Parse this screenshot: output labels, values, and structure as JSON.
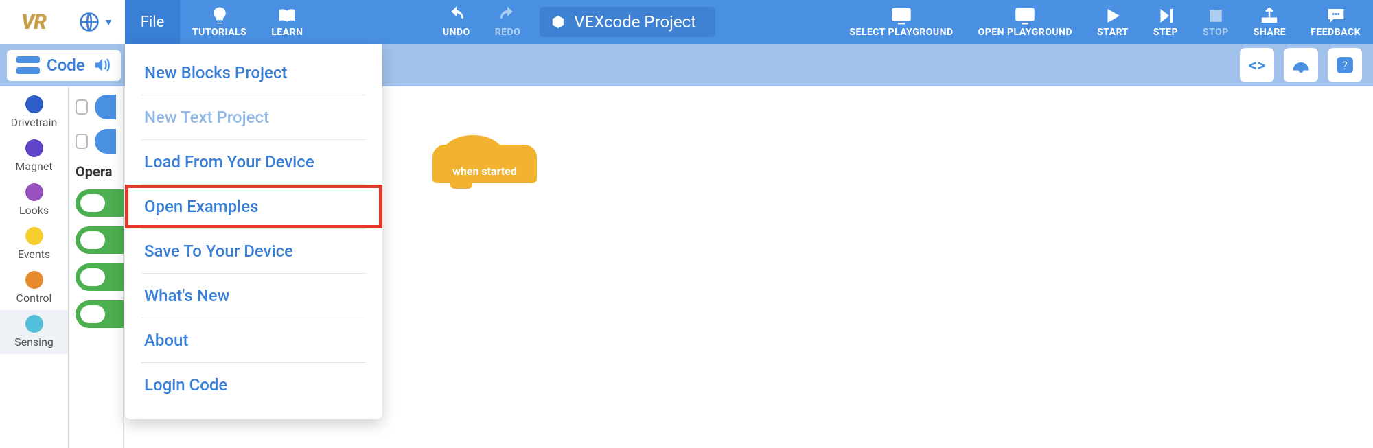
{
  "logo": "VR",
  "toolbar": {
    "file": "File",
    "tutorials": "TUTORIALS",
    "learn": "LEARN",
    "undo": "UNDO",
    "redo": "REDO",
    "select_playground": "SELECT PLAYGROUND",
    "open_playground": "OPEN PLAYGROUND",
    "start": "START",
    "step": "STEP",
    "stop": "STOP",
    "share": "SHARE",
    "feedback": "FEEDBACK"
  },
  "project_name": "VEXcode Project",
  "subbar": {
    "label": "Code"
  },
  "categories": [
    {
      "label": "Drivetrain",
      "cls": "c-drivetrain"
    },
    {
      "label": "Magnet",
      "cls": "c-magnet"
    },
    {
      "label": "Looks",
      "cls": "c-looks"
    },
    {
      "label": "Events",
      "cls": "c-events"
    },
    {
      "label": "Control",
      "cls": "c-control"
    },
    {
      "label": "Sensing",
      "cls": "c-sensing"
    }
  ],
  "palette_heading": "Opera",
  "file_menu": {
    "items": [
      {
        "label": "New Blocks Project",
        "disabled": false
      },
      {
        "label": "New Text Project",
        "disabled": true
      },
      {
        "label": "Load From Your Device",
        "disabled": false
      },
      {
        "label": "Open Examples",
        "disabled": false,
        "highlighted": true
      },
      {
        "label": "Save To Your Device",
        "disabled": false
      },
      {
        "label": "What's New",
        "disabled": false
      },
      {
        "label": "About",
        "disabled": false
      },
      {
        "label": "Login Code",
        "disabled": false
      }
    ]
  },
  "canvas": {
    "when_started": "when started"
  }
}
